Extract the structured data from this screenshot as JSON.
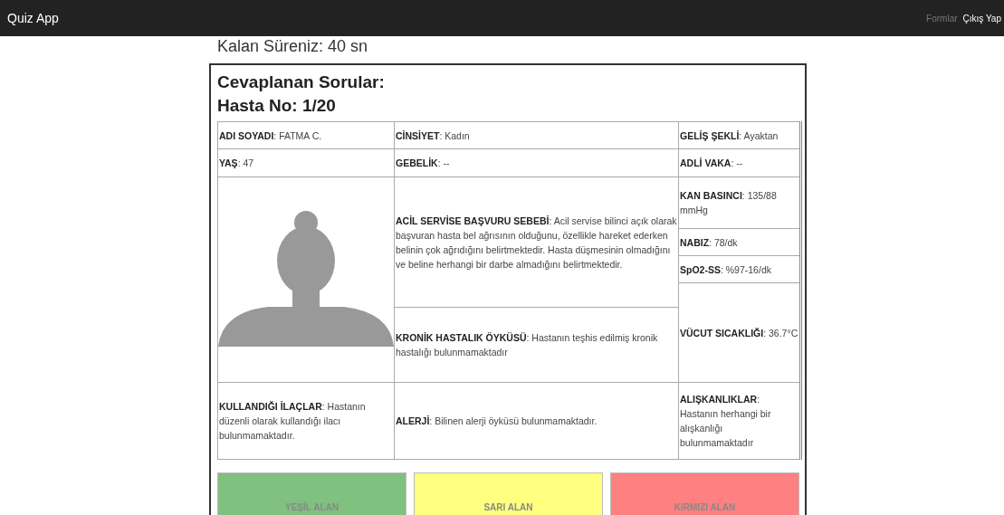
{
  "navbar": {
    "brand": "Quiz App",
    "links": [
      {
        "label": "Formlar",
        "active": false
      },
      {
        "label": "Çıkış Yap",
        "active": true
      }
    ]
  },
  "timer": "Kalan Süreniz: 40 sn",
  "card": {
    "title": "Cevaplanan Sorular:",
    "patient_no": "Hasta No: 1/20"
  },
  "table": {
    "name": "**ADI SOYADI**: FATMA C.",
    "gender": "**CİNSİYET**: Kadın",
    "arrival": "**GELİŞ ŞEKLİ**: Ayaktan",
    "age": "**YAŞ**: 47",
    "pregnancy": "**GEBELİK**: --",
    "forensic": "**ADLİ VAKA**: --",
    "complaint": "**ACİL SERVİSE BAŞVURU SEBEBİ**: Acil servise bilinci açık olarak başvuran hasta bel ağrısının olduğunu, özellikle hareket ederken belinin çok ağrıdığını belirtmektedir. Hasta düşmesinin olmadığını ve beline herhangi bir darbe almadığını belirtmektedir.",
    "blood_pressure": "**KAN BASINCI**: 135/88 mmHg",
    "pulse": "**NABIZ**: 78/dk",
    "spo2": "**SpO2-SS**: %97-16/dk",
    "temperature": "**VÜCUT SICAKLIĞI**: 36.7°C",
    "chronic": "**KRONİK HASTALIK ÖYKÜSÜ**: Hastanın teşhis edilmiş kronik hastalığı bulunmamaktadır",
    "medications": "**KULLANDIĞI İLAÇLAR**: Hastanın düzenli olarak kullandığı ilacı bulunmamaktadır.",
    "allergy": "**ALERJİ**: Bilinen alerji öyküsü bulunmamaktadır.",
    "habits": "**ALIŞKANLIKLAR**: Hastanın herhangi bir alışkanlığı bulunmamaktadır"
  },
  "zones": [
    {
      "label": "YEŞİL ALAN",
      "color": "#80c080"
    },
    {
      "label": "SARI ALAN",
      "color": "#ffff80"
    },
    {
      "label": "KIRMIZI ALAN",
      "color": "#ff8080"
    }
  ]
}
